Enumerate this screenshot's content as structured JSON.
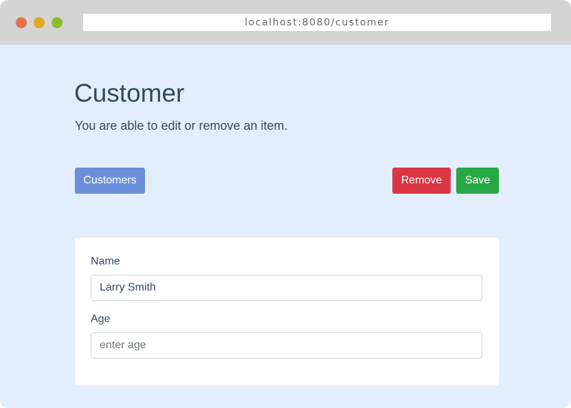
{
  "browser": {
    "url": "localhost:8080/customer"
  },
  "page": {
    "title": "Customer",
    "subtitle": "You are able to edit or remove an item."
  },
  "toolbar": {
    "customers_label": "Customers",
    "remove_label": "Remove",
    "save_label": "Save"
  },
  "form": {
    "name_label": "Name",
    "name_value": "Larry Smith",
    "age_label": "Age",
    "age_value": "",
    "age_placeholder": "enter age"
  },
  "colors": {
    "background": "#e2eefe",
    "primary": "#6c8fdc",
    "danger": "#dc3545",
    "success": "#28a745",
    "text": "#34495e"
  }
}
